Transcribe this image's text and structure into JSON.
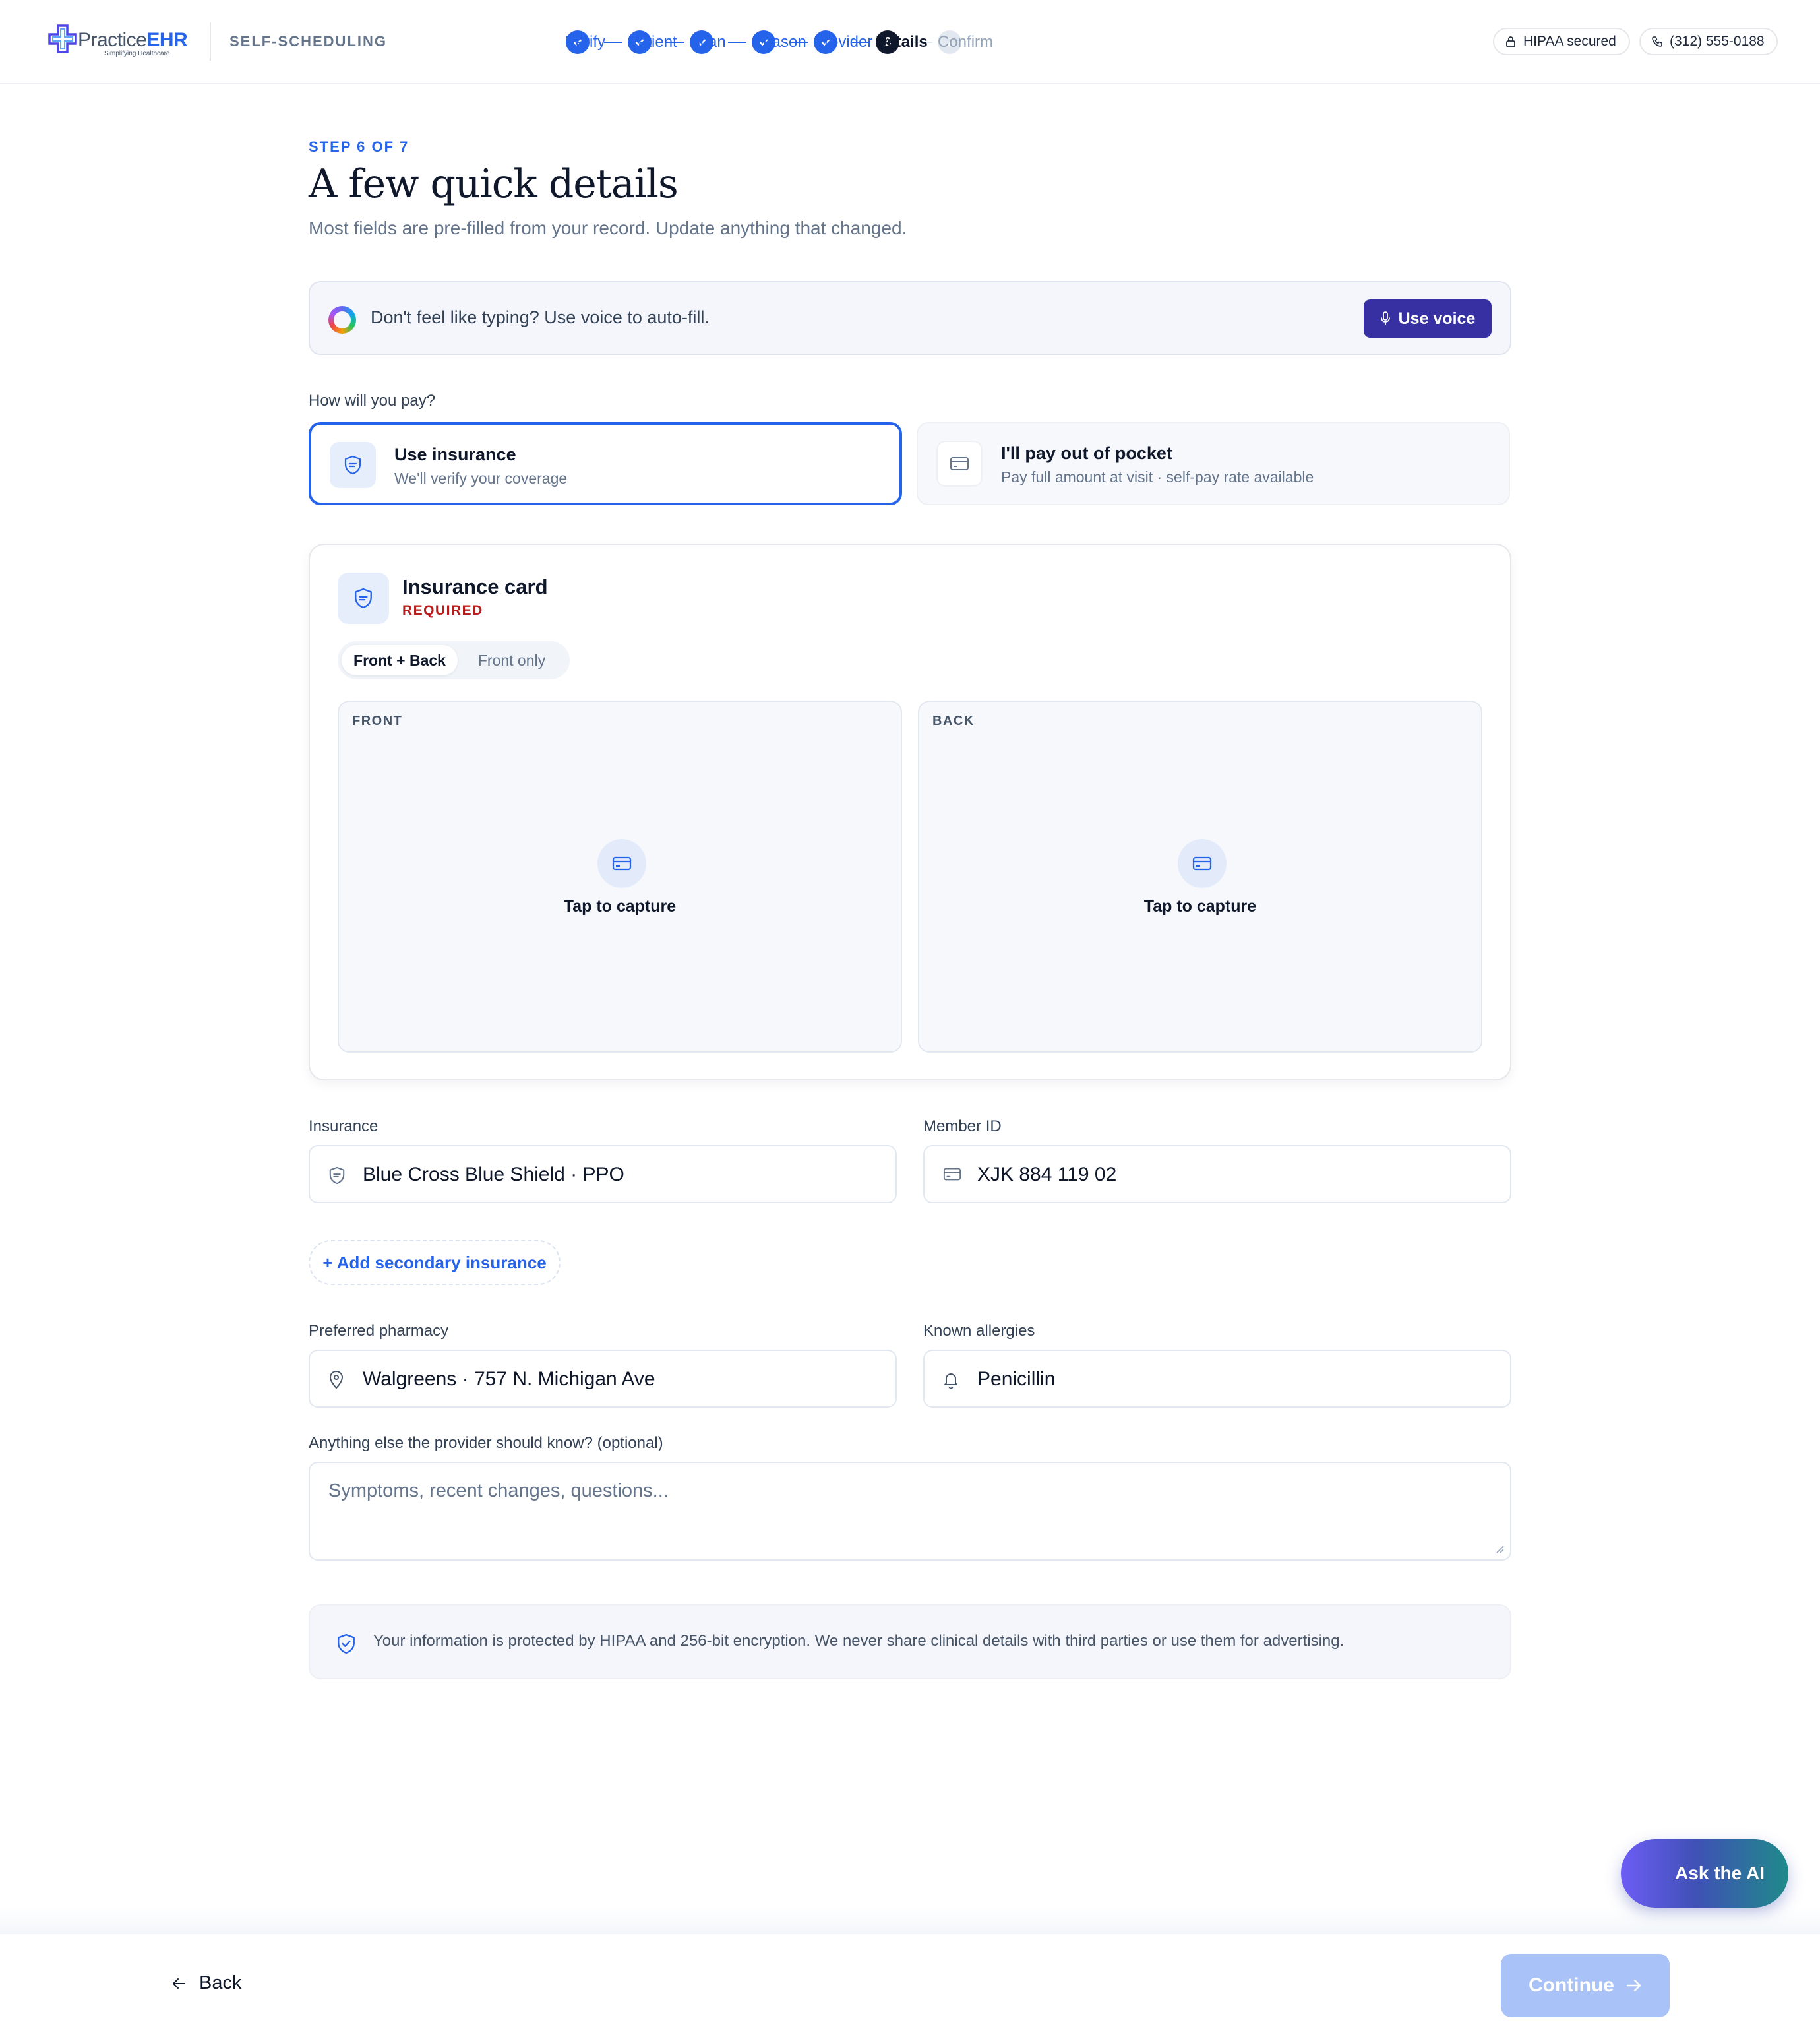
{
  "brand": {
    "name_light": "Practice",
    "name_bold": "EHR",
    "tagline": "Simplifying Healthcare",
    "section": "SELF-SCHEDULING"
  },
  "stepper": {
    "steps": [
      {
        "label": "Verify",
        "state": "done"
      },
      {
        "label": "Patient",
        "state": "done"
      },
      {
        "label": "Scan",
        "state": "done"
      },
      {
        "label": "Reason",
        "state": "done"
      },
      {
        "label": "Provider",
        "state": "done"
      },
      {
        "label": "Details",
        "state": "current",
        "number": "6"
      },
      {
        "label": "Confirm",
        "state": "todo",
        "number": "7"
      }
    ]
  },
  "header": {
    "hipaa_label": "HIPAA secured",
    "phone": "(312) 555-0188"
  },
  "page": {
    "kicker": "STEP 6 OF 7",
    "title": "A few quick details",
    "subtitle": "Most fields are pre-filled from your record. Update anything that changed."
  },
  "voice": {
    "prompt": "Don't feel like typing? Use voice to auto-fill.",
    "button": "Use voice"
  },
  "payment": {
    "question": "How will you pay?",
    "options": [
      {
        "title": "Use insurance",
        "desc": "We'll verify your coverage",
        "selected": true
      },
      {
        "title": "I'll pay out of pocket",
        "desc": "Pay full amount at visit · self-pay rate available",
        "selected": false
      }
    ]
  },
  "insurance_card": {
    "title": "Insurance card",
    "required": "REQUIRED",
    "mode_selected": "Front + Back",
    "mode_other": "Front only",
    "front_label": "FRONT",
    "back_label": "BACK",
    "capture_text": "Tap to capture"
  },
  "fields": {
    "insurance_label": "Insurance",
    "insurance_value": "Blue Cross Blue Shield · PPO",
    "member_id_label": "Member ID",
    "member_id_value": "XJK 884 119 02",
    "add_secondary": "+ Add secondary insurance",
    "pharmacy_label": "Preferred pharmacy",
    "pharmacy_value": "Walgreens · 757 N. Michigan Ave",
    "allergies_label": "Known allergies",
    "allergies_value": "Penicillin",
    "notes_label": "Anything else the provider should know? (optional)",
    "notes_placeholder": "Symptoms, recent changes, questions..."
  },
  "notice": "Your information is protected by HIPAA and 256-bit encryption. We never share clinical details with third parties or use them for advertising.",
  "ask_ai": "Ask the AI",
  "footer": {
    "back": "Back",
    "continue": "Continue"
  },
  "colors": {
    "accent": "#2563eb",
    "voice_button": "#3730a3",
    "required": "#b91c1c",
    "continue_disabled": "#a9c2f7"
  }
}
